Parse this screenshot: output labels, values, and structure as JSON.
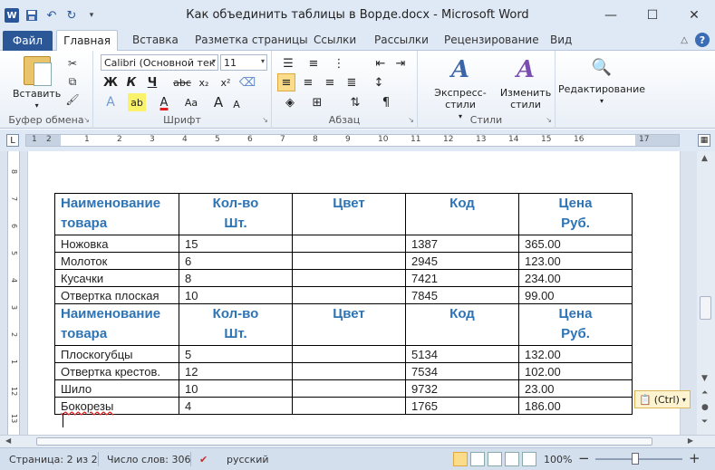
{
  "window": {
    "title": "Как объединить таблицы в Ворде.docx - Microsoft Word",
    "app_icon_letter": "W",
    "minimize": "—",
    "maximize": "☐",
    "close": "✕"
  },
  "tabs": {
    "file": "Файл",
    "active": "Главная",
    "items": [
      "Вставка",
      "Разметка страницы",
      "Ссылки",
      "Рассылки",
      "Рецензирование",
      "Вид"
    ]
  },
  "ribbon": {
    "paste_label": "Вставить",
    "clipboard_group": "Буфер обмена",
    "font_group": "Шрифт",
    "font_name": "Calibri (Основной тек",
    "font_size": "11",
    "paragraph_group": "Абзац",
    "styles_group": "Стили",
    "quick_styles": "Экспресс-стили",
    "change_styles_line1": "Изменить",
    "change_styles_line2": "стили",
    "editing": "Редактирование",
    "bold": "Ж",
    "italic": "К",
    "underline": "Ч",
    "strike": "abc",
    "subscript": "x₂",
    "superscript": "x²",
    "grow_font": "A",
    "shrink_font": "A",
    "font_color": "А",
    "change_case": "Aa",
    "pilcrow": "¶"
  },
  "ruler": {
    "numbers": [
      "1",
      "2",
      "1",
      "2",
      "3",
      "4",
      "5",
      "6",
      "7",
      "8",
      "9",
      "10",
      "11",
      "12",
      "13",
      "14",
      "15",
      "16",
      "17"
    ]
  },
  "table": {
    "header": [
      "Наименование товара",
      "Кол-во Шт.",
      "Цвет",
      "Код",
      "Цена Руб."
    ],
    "header_lines": [
      [
        "Наименование",
        "товара"
      ],
      [
        "Кол-во",
        "Шт."
      ],
      [
        "Цвет",
        ""
      ],
      [
        "Код",
        ""
      ],
      [
        "Цена",
        "Руб."
      ]
    ],
    "rows_part1": [
      [
        "Ножовка",
        "15",
        "",
        "1387",
        "365.00"
      ],
      [
        "Молоток",
        "6",
        "",
        "2945",
        "123.00"
      ],
      [
        "Кусачки",
        "8",
        "",
        "7421",
        "234.00"
      ],
      [
        "Отвертка плоская",
        "10",
        "",
        "7845",
        "99.00"
      ]
    ],
    "rows_part2": [
      [
        "Плоскогубцы",
        "5",
        "",
        "5134",
        "132.00"
      ],
      [
        "Отвертка крестов.",
        "12",
        "",
        "7534",
        "102.00"
      ],
      [
        "Шило",
        "10",
        "",
        "9732",
        "23.00"
      ],
      [
        "Бокорезы",
        "4",
        "",
        "1765",
        "186.00"
      ]
    ]
  },
  "paste_options": "(Ctrl)",
  "status": {
    "page": "Страница: 2 из 2",
    "words": "Число слов: 306",
    "language": "русский",
    "zoom": "100%",
    "zoom_minus": "−",
    "zoom_plus": "+"
  }
}
